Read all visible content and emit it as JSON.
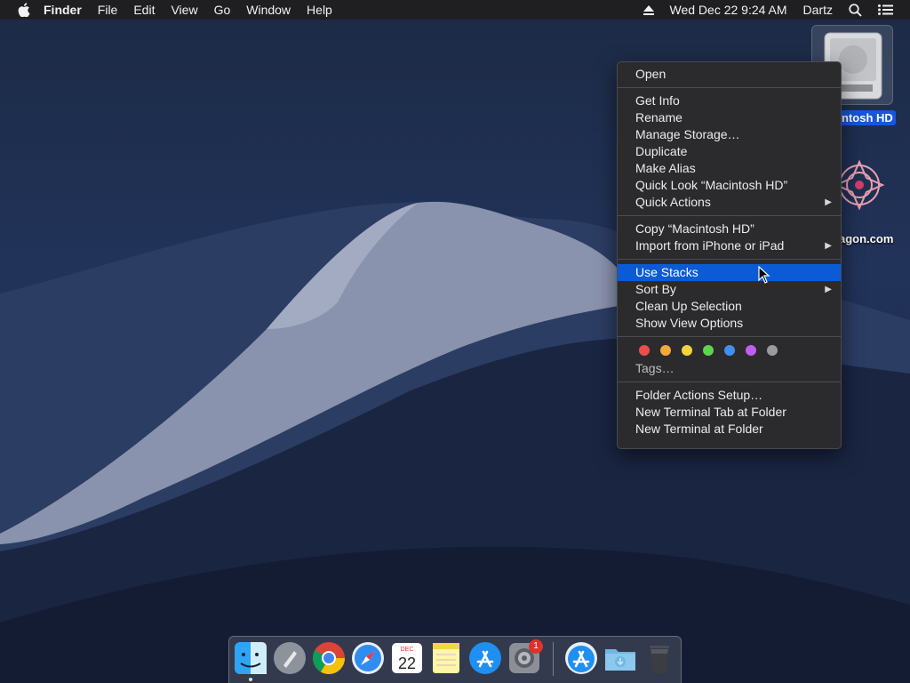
{
  "menubar": {
    "app_name": "Finder",
    "menus": [
      "File",
      "Edit",
      "View",
      "Go",
      "Window",
      "Help"
    ],
    "datetime": "Wed Dec 22  9:24 AM",
    "user": "Dartz"
  },
  "desktop": {
    "hd_label": "ntosh HD",
    "app2_label": "agon.com"
  },
  "context_menu": {
    "groups": [
      [
        "Open"
      ],
      [
        "Get Info",
        "Rename",
        "Manage Storage…",
        "Duplicate",
        "Make Alias",
        "Quick Look “Macintosh HD”",
        "Quick Actions"
      ],
      [
        "Copy “Macintosh HD”",
        "Import from iPhone or iPad"
      ],
      [
        "Use Stacks",
        "Sort By",
        "Clean Up Selection",
        "Show View Options"
      ],
      [
        "Folder Actions Setup…",
        "New Terminal Tab at Folder",
        "New Terminal at Folder"
      ]
    ],
    "highlighted": "Use Stacks",
    "submenu_items": [
      "Quick Actions",
      "Import from iPhone or iPad",
      "Sort By"
    ],
    "tag_colors": [
      "#ee4d48",
      "#f4a83a",
      "#f6d33c",
      "#5bd64a",
      "#3f8ff2",
      "#c05df2",
      "#9b9b9d"
    ],
    "tags_label": "Tags…"
  },
  "dock": {
    "calendar_month": "DEC",
    "calendar_day": "22",
    "badge_count": "1"
  },
  "colors": {
    "menu_bg": "#2b2b2d",
    "highlight": "#0b5bd6",
    "label_selected": "#1657d8"
  }
}
